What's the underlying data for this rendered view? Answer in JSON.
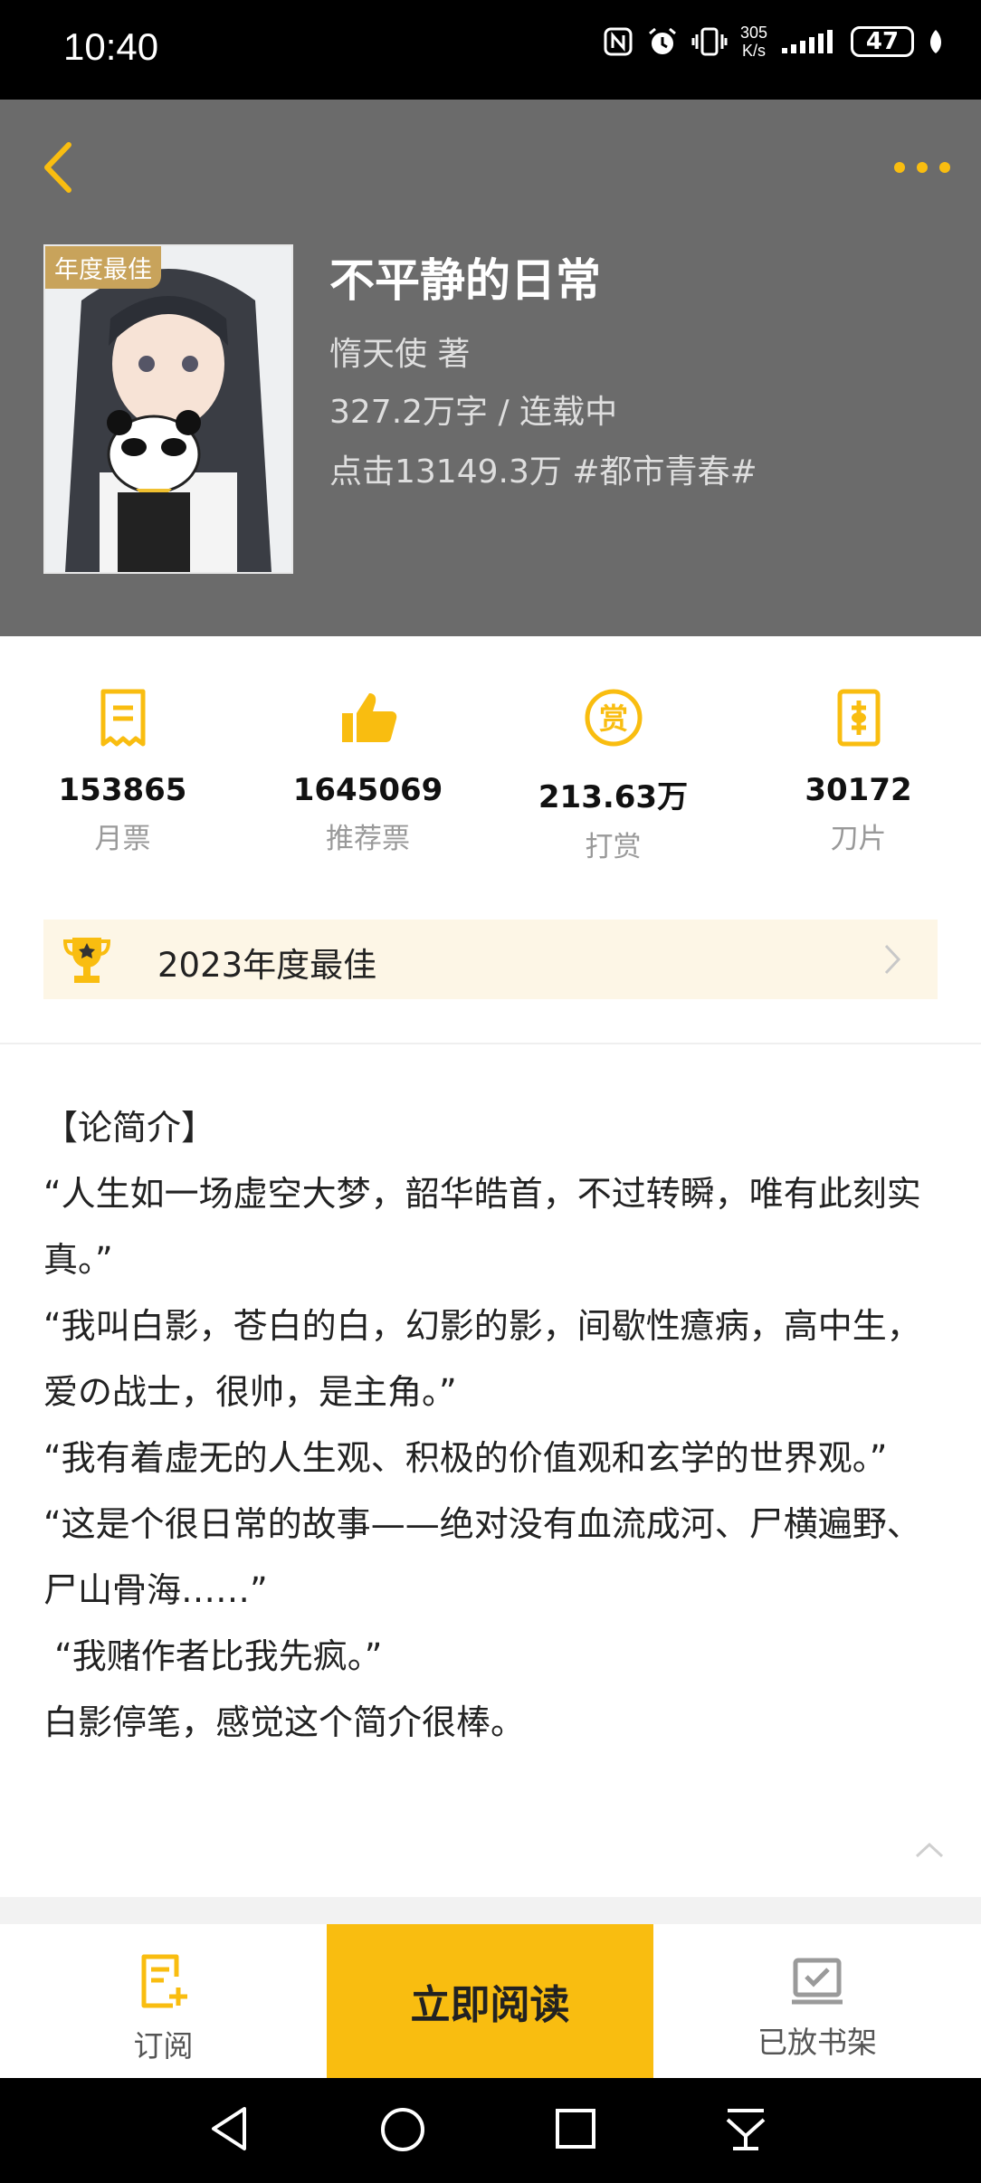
{
  "status": {
    "time": "10:40",
    "net_speed_value": "305",
    "net_speed_unit": "K/s",
    "battery": "47"
  },
  "book": {
    "badge": "年度最佳",
    "title": "不平静的日常",
    "author_line": "惰天使  著",
    "words_line": "327.2万字 / 连载中",
    "clicks_line": "点击13149.3万  #都市青春#"
  },
  "stats": [
    {
      "value": "153865",
      "label": "月票",
      "icon": "monthly-ticket-icon"
    },
    {
      "value": "1645069",
      "label": "推荐票",
      "icon": "thumbs-up-icon"
    },
    {
      "value": "213.63万",
      "label": "打赏",
      "icon": "reward-icon"
    },
    {
      "value": "30172",
      "label": "刀片",
      "icon": "blade-icon"
    }
  ],
  "award": {
    "text": "2023年度最佳"
  },
  "intro": {
    "lines": [
      "【论简介】",
      "“人生如一场虚空大梦，韶华皓首，不过转瞬，唯有此刻实真。”",
      "“我叫白影，苍白的白，幻影的影，间歇性癔病，高中生，爱の战士，很帅，是主角。”",
      "“我有着虚无的人生观、积极的价值观和玄学的世界观。”",
      "“这是个很日常的故事——绝对没有血流成河、尸横遍野、尸山骨海……”",
      " “我赌作者比我先疯。”",
      "白影停笔，感觉这个简介很棒。"
    ]
  },
  "bottom": {
    "subscribe": "订阅",
    "read": "立即阅读",
    "shelf": "已放书架"
  },
  "colors": {
    "accent": "#f9bd10",
    "header_bg": "#6b6b6b"
  }
}
